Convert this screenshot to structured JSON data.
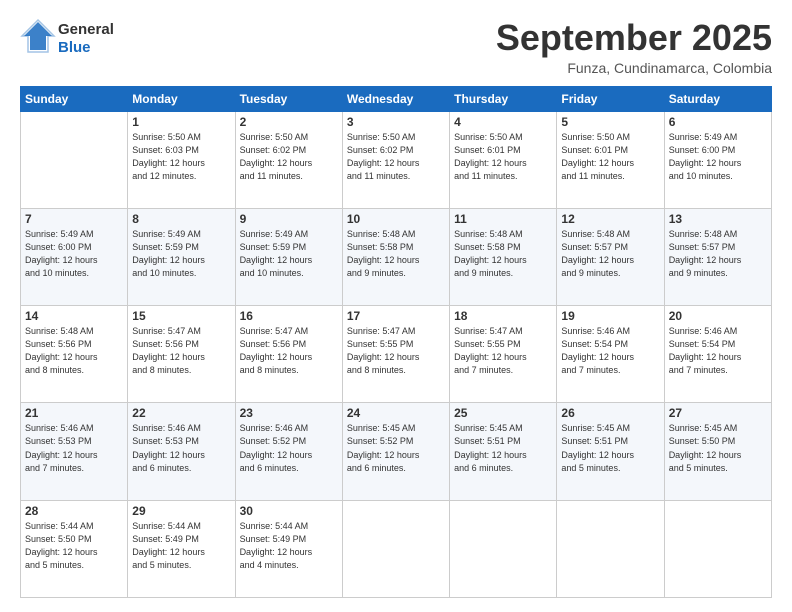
{
  "header": {
    "logo_general": "General",
    "logo_blue": "Blue",
    "month_title": "September 2025",
    "location": "Funza, Cundinamarca, Colombia"
  },
  "days_of_week": [
    "Sunday",
    "Monday",
    "Tuesday",
    "Wednesday",
    "Thursday",
    "Friday",
    "Saturday"
  ],
  "weeks": [
    [
      {
        "day": "",
        "info": ""
      },
      {
        "day": "1",
        "info": "Sunrise: 5:50 AM\nSunset: 6:03 PM\nDaylight: 12 hours\nand 12 minutes."
      },
      {
        "day": "2",
        "info": "Sunrise: 5:50 AM\nSunset: 6:02 PM\nDaylight: 12 hours\nand 11 minutes."
      },
      {
        "day": "3",
        "info": "Sunrise: 5:50 AM\nSunset: 6:02 PM\nDaylight: 12 hours\nand 11 minutes."
      },
      {
        "day": "4",
        "info": "Sunrise: 5:50 AM\nSunset: 6:01 PM\nDaylight: 12 hours\nand 11 minutes."
      },
      {
        "day": "5",
        "info": "Sunrise: 5:50 AM\nSunset: 6:01 PM\nDaylight: 12 hours\nand 11 minutes."
      },
      {
        "day": "6",
        "info": "Sunrise: 5:49 AM\nSunset: 6:00 PM\nDaylight: 12 hours\nand 10 minutes."
      }
    ],
    [
      {
        "day": "7",
        "info": "Sunrise: 5:49 AM\nSunset: 6:00 PM\nDaylight: 12 hours\nand 10 minutes."
      },
      {
        "day": "8",
        "info": "Sunrise: 5:49 AM\nSunset: 5:59 PM\nDaylight: 12 hours\nand 10 minutes."
      },
      {
        "day": "9",
        "info": "Sunrise: 5:49 AM\nSunset: 5:59 PM\nDaylight: 12 hours\nand 10 minutes."
      },
      {
        "day": "10",
        "info": "Sunrise: 5:48 AM\nSunset: 5:58 PM\nDaylight: 12 hours\nand 9 minutes."
      },
      {
        "day": "11",
        "info": "Sunrise: 5:48 AM\nSunset: 5:58 PM\nDaylight: 12 hours\nand 9 minutes."
      },
      {
        "day": "12",
        "info": "Sunrise: 5:48 AM\nSunset: 5:57 PM\nDaylight: 12 hours\nand 9 minutes."
      },
      {
        "day": "13",
        "info": "Sunrise: 5:48 AM\nSunset: 5:57 PM\nDaylight: 12 hours\nand 9 minutes."
      }
    ],
    [
      {
        "day": "14",
        "info": "Sunrise: 5:48 AM\nSunset: 5:56 PM\nDaylight: 12 hours\nand 8 minutes."
      },
      {
        "day": "15",
        "info": "Sunrise: 5:47 AM\nSunset: 5:56 PM\nDaylight: 12 hours\nand 8 minutes."
      },
      {
        "day": "16",
        "info": "Sunrise: 5:47 AM\nSunset: 5:56 PM\nDaylight: 12 hours\nand 8 minutes."
      },
      {
        "day": "17",
        "info": "Sunrise: 5:47 AM\nSunset: 5:55 PM\nDaylight: 12 hours\nand 8 minutes."
      },
      {
        "day": "18",
        "info": "Sunrise: 5:47 AM\nSunset: 5:55 PM\nDaylight: 12 hours\nand 7 minutes."
      },
      {
        "day": "19",
        "info": "Sunrise: 5:46 AM\nSunset: 5:54 PM\nDaylight: 12 hours\nand 7 minutes."
      },
      {
        "day": "20",
        "info": "Sunrise: 5:46 AM\nSunset: 5:54 PM\nDaylight: 12 hours\nand 7 minutes."
      }
    ],
    [
      {
        "day": "21",
        "info": "Sunrise: 5:46 AM\nSunset: 5:53 PM\nDaylight: 12 hours\nand 7 minutes."
      },
      {
        "day": "22",
        "info": "Sunrise: 5:46 AM\nSunset: 5:53 PM\nDaylight: 12 hours\nand 6 minutes."
      },
      {
        "day": "23",
        "info": "Sunrise: 5:46 AM\nSunset: 5:52 PM\nDaylight: 12 hours\nand 6 minutes."
      },
      {
        "day": "24",
        "info": "Sunrise: 5:45 AM\nSunset: 5:52 PM\nDaylight: 12 hours\nand 6 minutes."
      },
      {
        "day": "25",
        "info": "Sunrise: 5:45 AM\nSunset: 5:51 PM\nDaylight: 12 hours\nand 6 minutes."
      },
      {
        "day": "26",
        "info": "Sunrise: 5:45 AM\nSunset: 5:51 PM\nDaylight: 12 hours\nand 5 minutes."
      },
      {
        "day": "27",
        "info": "Sunrise: 5:45 AM\nSunset: 5:50 PM\nDaylight: 12 hours\nand 5 minutes."
      }
    ],
    [
      {
        "day": "28",
        "info": "Sunrise: 5:44 AM\nSunset: 5:50 PM\nDaylight: 12 hours\nand 5 minutes."
      },
      {
        "day": "29",
        "info": "Sunrise: 5:44 AM\nSunset: 5:49 PM\nDaylight: 12 hours\nand 5 minutes."
      },
      {
        "day": "30",
        "info": "Sunrise: 5:44 AM\nSunset: 5:49 PM\nDaylight: 12 hours\nand 4 minutes."
      },
      {
        "day": "",
        "info": ""
      },
      {
        "day": "",
        "info": ""
      },
      {
        "day": "",
        "info": ""
      },
      {
        "day": "",
        "info": ""
      }
    ]
  ]
}
